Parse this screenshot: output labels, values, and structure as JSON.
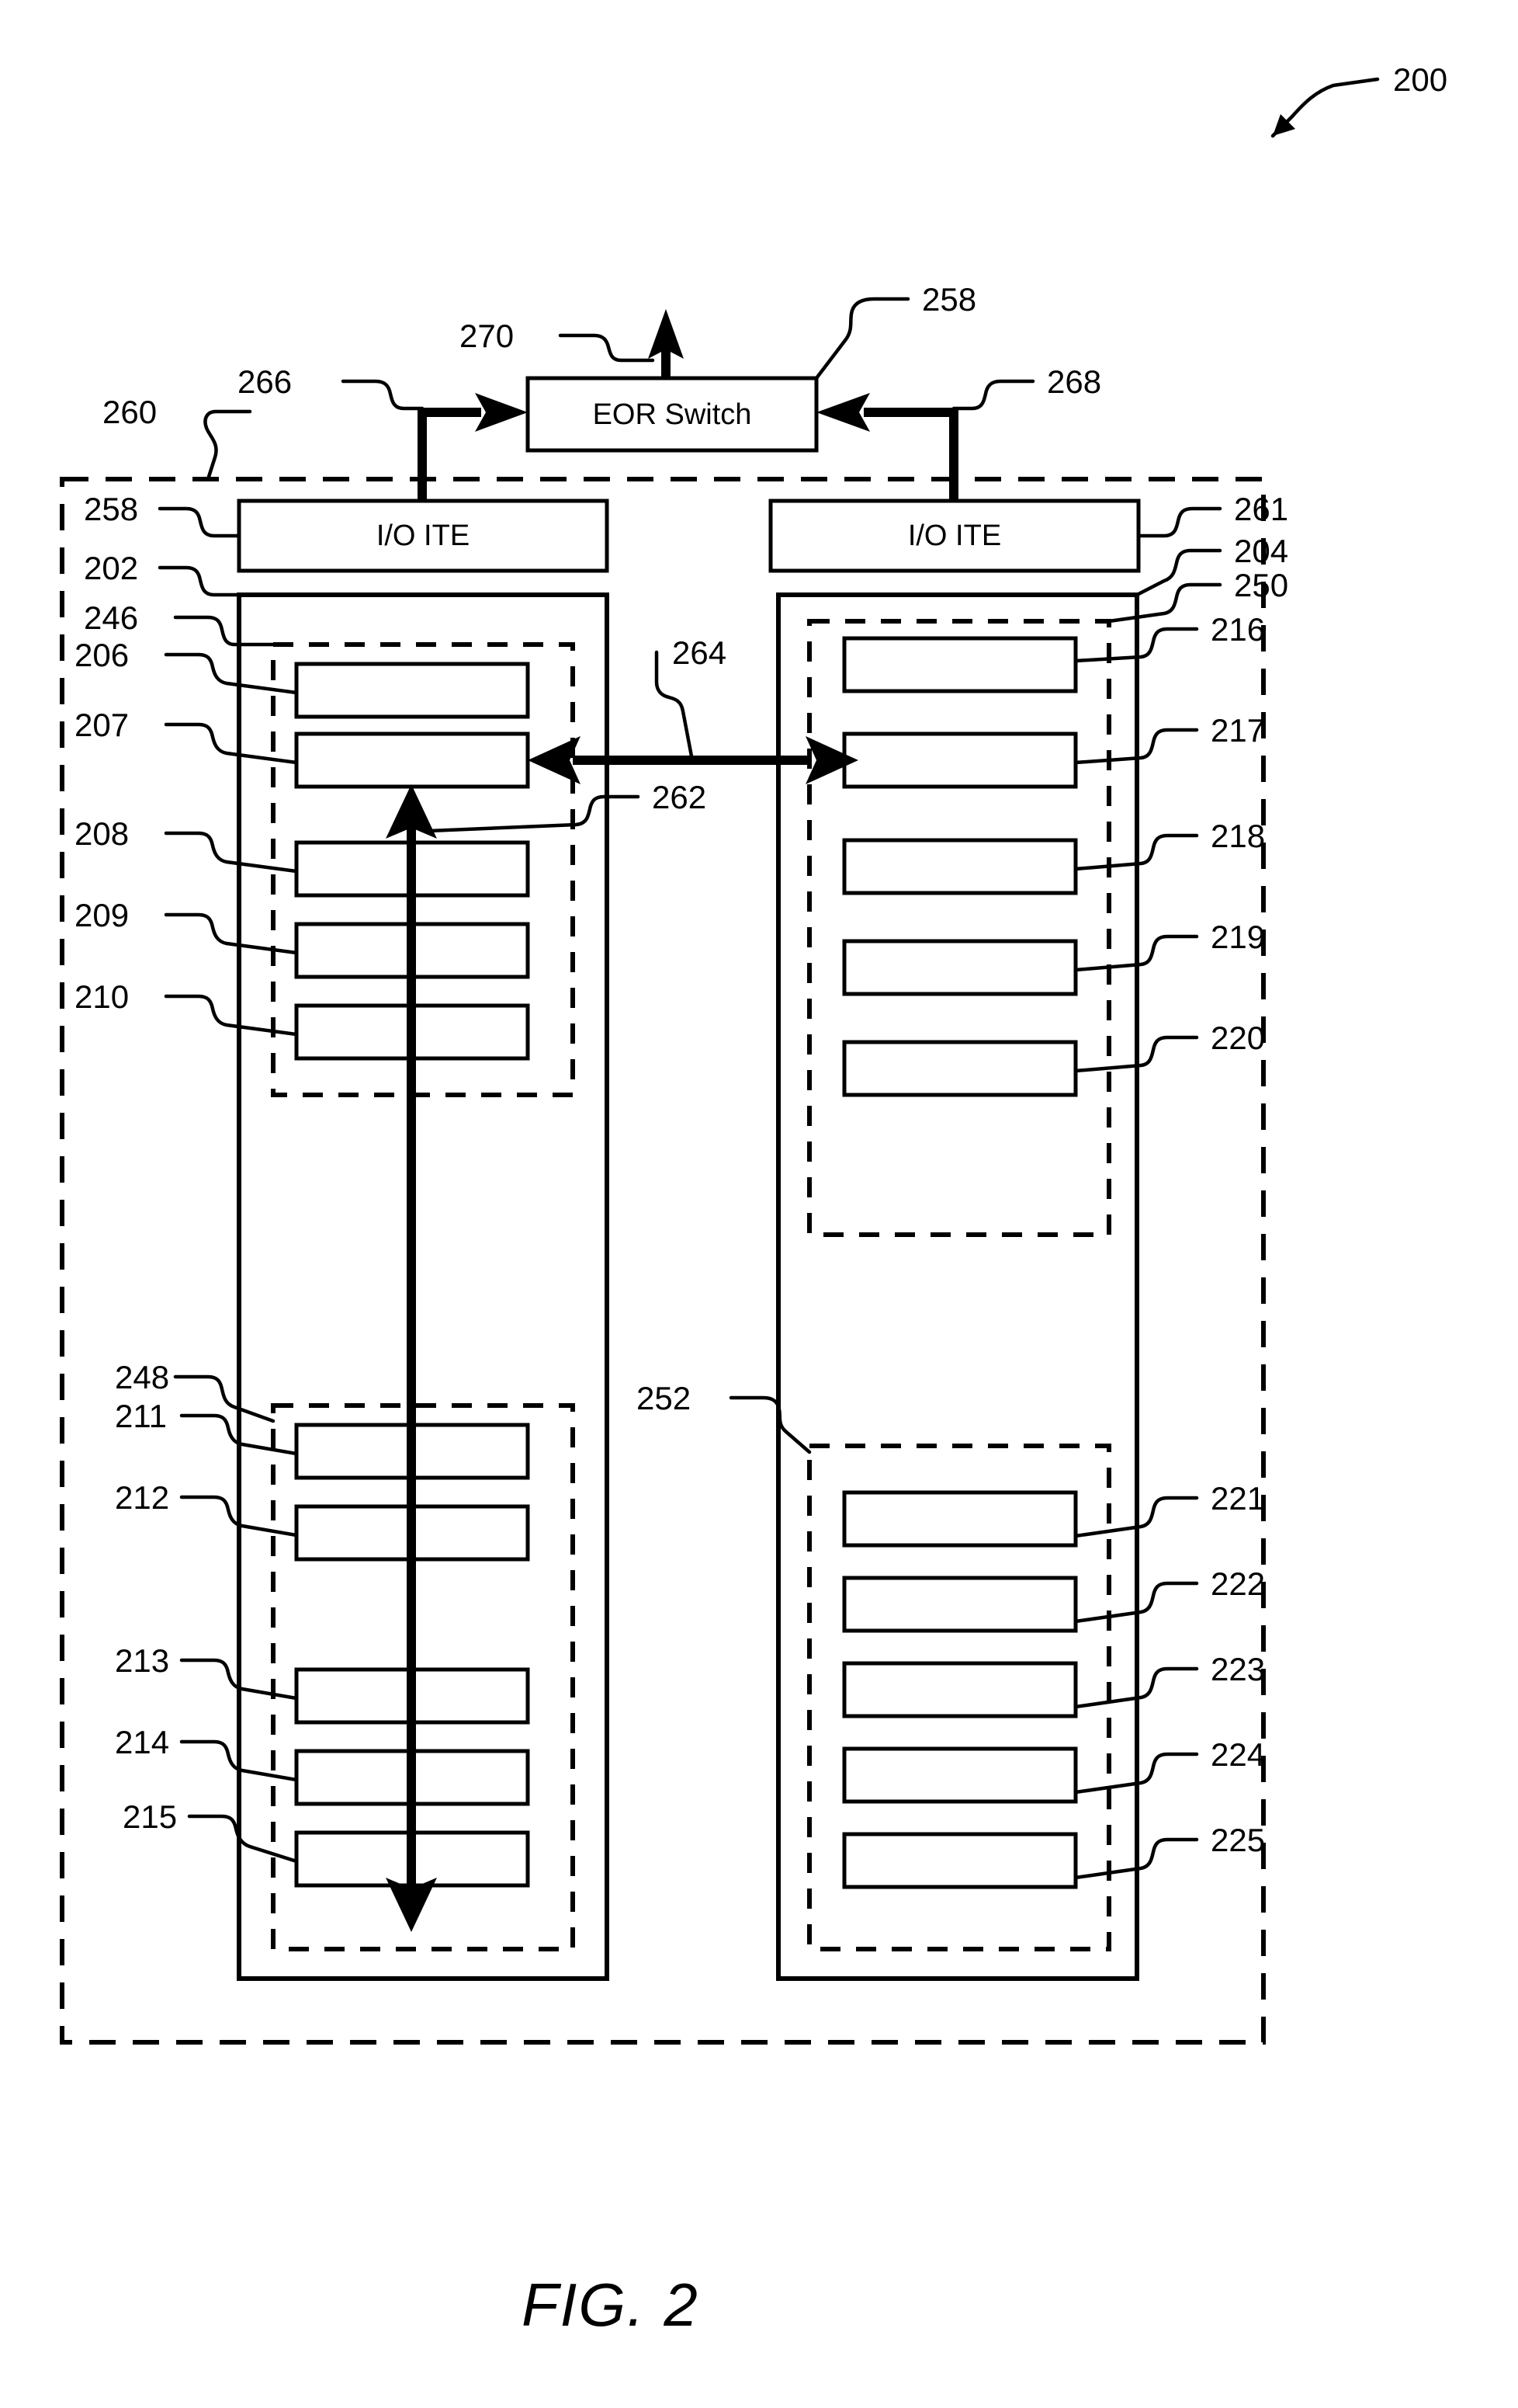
{
  "figure": {
    "caption": "FIG. 2",
    "top_reference": "200"
  },
  "switch": {
    "label": "EOR Switch",
    "ref": "258",
    "uplink_ref": "270",
    "left_link_ref": "266",
    "right_link_ref": "268"
  },
  "outer_enclosure": {
    "ref": "260"
  },
  "racks": [
    {
      "id": "left-rack",
      "ref": "202",
      "io_ite_label": "I/O ITE",
      "io_ite_ref": "258",
      "groups": [
        {
          "ref": "246",
          "items": [
            {
              "ref": "206"
            },
            {
              "ref": "207"
            },
            {
              "ref": "208"
            },
            {
              "ref": "209"
            },
            {
              "ref": "210"
            }
          ]
        },
        {
          "ref": "248",
          "items": [
            {
              "ref": "211"
            },
            {
              "ref": "212"
            },
            {
              "ref": "213"
            },
            {
              "ref": "214"
            },
            {
              "ref": "215"
            }
          ]
        }
      ]
    },
    {
      "id": "right-rack",
      "ref": "204",
      "io_ite_label": "I/O ITE",
      "io_ite_ref": "261",
      "groups": [
        {
          "ref": "250",
          "items": [
            {
              "ref": "216"
            },
            {
              "ref": "217"
            },
            {
              "ref": "218"
            },
            {
              "ref": "219"
            },
            {
              "ref": "220"
            }
          ]
        },
        {
          "ref": "252",
          "items": [
            {
              "ref": "221"
            },
            {
              "ref": "222"
            },
            {
              "ref": "223"
            },
            {
              "ref": "224"
            },
            {
              "ref": "225"
            }
          ]
        }
      ]
    }
  ],
  "connections": {
    "intra_rack_vertical_ref": "262",
    "inter_rack_horizontal_ref": "264"
  },
  "colors": {
    "ink": "#000000",
    "paper": "#ffffff"
  }
}
